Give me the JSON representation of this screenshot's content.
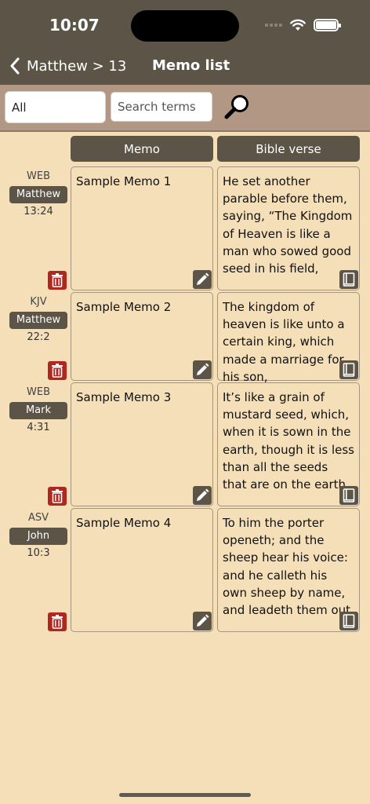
{
  "status": {
    "time": "10:07"
  },
  "nav": {
    "back_label": "Matthew > 13",
    "title": "Memo list"
  },
  "search": {
    "filter_value": "All",
    "placeholder": "Search terms"
  },
  "columns": {
    "memo": "Memo",
    "verse": "Bible verse"
  },
  "memos": [
    {
      "version": "WEB",
      "book": "Matthew",
      "ref": "13:24",
      "memo": "Sample Memo 1",
      "verse": "He set another parable before them, saying, “The Kingdom of Heaven is like a man who sowed good seed in his field,"
    },
    {
      "version": "KJV",
      "book": "Matthew",
      "ref": "22:2",
      "memo": "Sample Memo 2",
      "verse": "The kingdom of heaven is like unto a certain king, which made a marriage for his son,"
    },
    {
      "version": "WEB",
      "book": "Mark",
      "ref": "4:31",
      "memo": "Sample Memo 3",
      "verse": "It’s like a grain of mustard seed, which, when it is sown in the earth, though it is less than all the seeds that are on the earth,"
    },
    {
      "version": "ASV",
      "book": "John",
      "ref": "10:3",
      "memo": "Sample Memo 4",
      "verse": "To him the porter openeth; and the sheep hear his voice: and he calleth his own sheep by name, and leadeth them out."
    }
  ],
  "colors": {
    "header_bg": "#5c5447",
    "page_bg": "#f4dfb9",
    "search_bg": "#b29784",
    "delete": "#b0271f"
  }
}
